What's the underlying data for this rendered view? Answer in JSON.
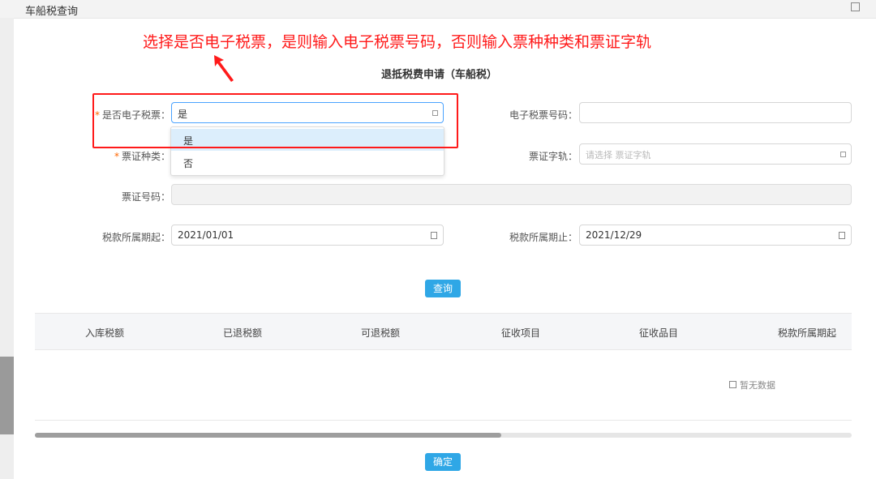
{
  "window": {
    "title": "车船税查询"
  },
  "annotation": {
    "text": "选择是否电子税票，是则输入电子税票号码，否则输入票种种类和票证字轨"
  },
  "form": {
    "title": "退抵税费申请（车船税）",
    "is_e_ticket": {
      "label": "是否电子税票：",
      "value": "是",
      "options": [
        "是",
        "否"
      ]
    },
    "e_ticket_no": {
      "label": "电子税票号码：",
      "value": ""
    },
    "ticket_type": {
      "label": "票证种类："
    },
    "ticket_track": {
      "label": "票证字轨：",
      "placeholder": "请选择 票证字轨"
    },
    "ticket_no": {
      "label": "票证号码："
    },
    "period_start": {
      "label": "税款所属期起：",
      "value": "2021/01/01"
    },
    "period_end": {
      "label": "税款所属期止：",
      "value": "2021/12/29"
    },
    "query_button": "查询"
  },
  "table": {
    "columns": [
      "入库税额",
      "已退税额",
      "可退税额",
      "征收项目",
      "征收品目",
      "税款所属期起"
    ],
    "empty_text": "暂无数据"
  },
  "confirm_button": "确定",
  "colors": {
    "accent": "#2fa7e6",
    "annotation": "#ff1a1a",
    "required": "#ff6600"
  }
}
